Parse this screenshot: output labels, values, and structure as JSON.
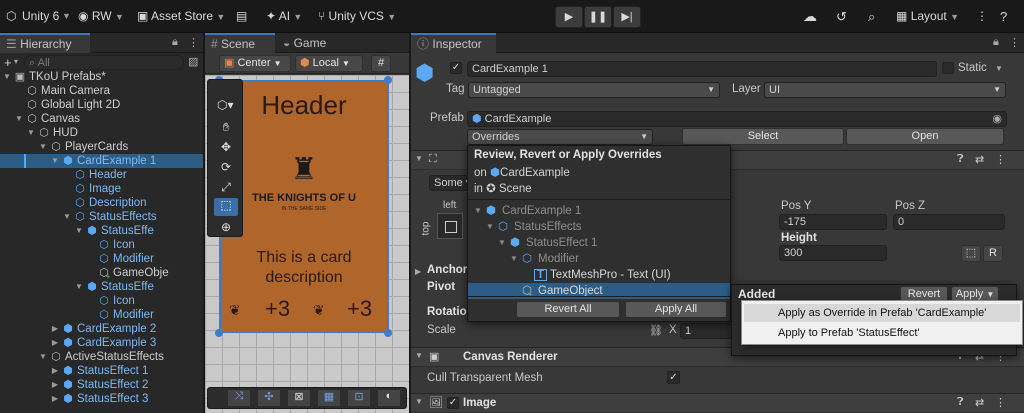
{
  "toolbar": {
    "app": "Unity 6",
    "account": "RW",
    "asset_store": "Asset Store",
    "ai": "AI",
    "vcs": "Unity VCS",
    "layout": "Layout"
  },
  "hierarchy": {
    "tab": "Hierarchy",
    "search_placeholder": "All",
    "rows": [
      {
        "label": "TKoU Prefabs*"
      },
      {
        "label": "Main Camera"
      },
      {
        "label": "Global Light 2D"
      },
      {
        "label": "Canvas"
      },
      {
        "label": "HUD"
      },
      {
        "label": "PlayerCards"
      },
      {
        "label": "CardExample 1"
      },
      {
        "label": "Header"
      },
      {
        "label": "Image"
      },
      {
        "label": "Description"
      },
      {
        "label": "StatusEffects"
      },
      {
        "label": "StatusEffe"
      },
      {
        "label": "Icon"
      },
      {
        "label": "Modifier"
      },
      {
        "label": "GameObje"
      },
      {
        "label": "StatusEffe"
      },
      {
        "label": "Icon"
      },
      {
        "label": "Modifier"
      },
      {
        "label": "CardExample 2"
      },
      {
        "label": "CardExample 3"
      },
      {
        "label": "ActiveStatusEffects"
      },
      {
        "label": "StatusEffect 1"
      },
      {
        "label": "StatusEffect 2"
      },
      {
        "label": "StatusEffect 3"
      }
    ]
  },
  "scene": {
    "tab_scene": "Scene",
    "tab_game": "Game",
    "pivot": "Center",
    "space": "Local",
    "card_header": "Header",
    "card_logo": "THE KNIGHTS OF U",
    "card_logo_sub": "IN THE SAME SIDE",
    "card_desc": "This is a card description",
    "card_val1": "+3",
    "card_val2": "+3"
  },
  "inspector": {
    "tab": "Inspector",
    "object_name": "CardExample 1",
    "static_label": "Static",
    "tag_label": "Tag",
    "tag_value": "Untagged",
    "layer_label": "Layer",
    "layer_value": "UI",
    "prefab_label": "Prefab",
    "prefab_value": "CardExample",
    "overrides": "Overrides",
    "select": "Select",
    "open": "Open",
    "some_val": "Some va",
    "left": "left",
    "top": "top",
    "pos_y_label": "Pos Y",
    "pos_y": "-175",
    "pos_z_label": "Pos Z",
    "pos_z": "0",
    "height_label": "Height",
    "height": "300",
    "r_btn": "R",
    "anchors": "Anchors",
    "pivot": "Pivot",
    "rotation": "Rotation",
    "scale": "Scale",
    "scale_x_label": "X",
    "scale_x": "1",
    "canvas_renderer": "Canvas Renderer",
    "cull": "Cull Transparent Mesh",
    "image": "Image"
  },
  "overrides_popup": {
    "title": "Review, Revert or Apply Overrides",
    "on_label": "on",
    "on_value": "CardExample",
    "in_label": "in",
    "in_value": "Scene",
    "tree": [
      {
        "label": "CardExample 1"
      },
      {
        "label": "StatusEffects"
      },
      {
        "label": "StatusEffect 1"
      },
      {
        "label": "Modifier"
      },
      {
        "label": "TextMeshPro - Text (UI)"
      },
      {
        "label": "GameObject"
      }
    ],
    "revert_all": "Revert All",
    "apply_all": "Apply All"
  },
  "added_popup": {
    "title": "Added",
    "revert": "Revert",
    "apply": "Apply"
  },
  "context_menu": {
    "item1": "Apply as Override in Prefab 'CardExample'",
    "item2": "Apply to Prefab 'StatusEffect'"
  },
  "colors": {
    "selection": "#2c5d87",
    "prefab_blue": "#5aa9f5",
    "accent": "#3a79bb",
    "card_brown": "#b0652a"
  }
}
